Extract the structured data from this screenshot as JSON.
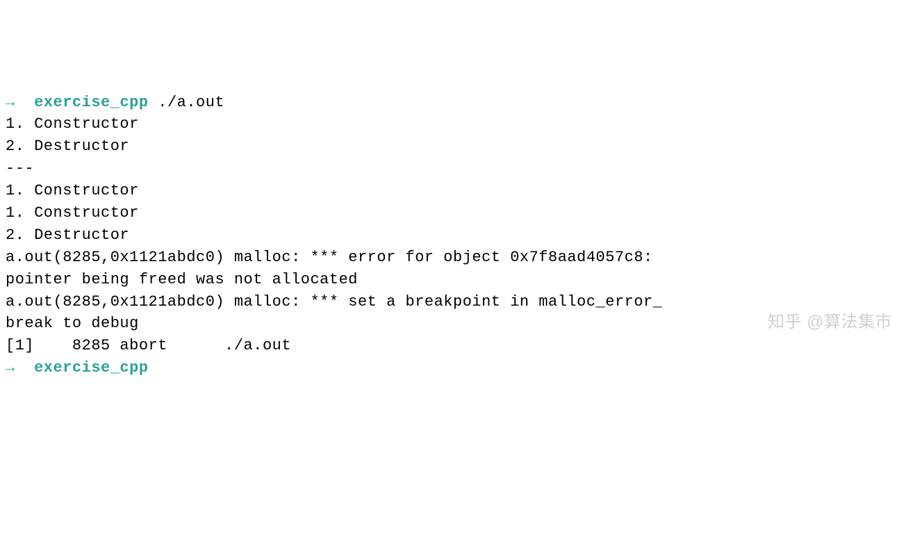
{
  "terminal": {
    "lines": [
      {
        "segments": [
          {
            "text": "→  ",
            "class": "prompt-arrow"
          },
          {
            "text": "exercise_cpp",
            "class": "prompt-dir"
          },
          {
            "text": " ./a.out",
            "class": "normal"
          }
        ]
      },
      {
        "segments": [
          {
            "text": "1. Constructor",
            "class": "normal"
          }
        ]
      },
      {
        "segments": [
          {
            "text": "2. Destructor",
            "class": "normal"
          }
        ]
      },
      {
        "segments": [
          {
            "text": "---",
            "class": "normal"
          }
        ]
      },
      {
        "segments": [
          {
            "text": "1. Constructor",
            "class": "normal"
          }
        ]
      },
      {
        "segments": [
          {
            "text": "1. Constructor",
            "class": "normal"
          }
        ]
      },
      {
        "segments": [
          {
            "text": "2. Destructor",
            "class": "normal"
          }
        ]
      },
      {
        "segments": [
          {
            "text": "a.out(8285,0x1121abdc0) malloc: *** error for object 0x7f8aad4057c8:",
            "class": "normal"
          }
        ]
      },
      {
        "segments": [
          {
            "text": "pointer being freed was not allocated",
            "class": "normal"
          }
        ]
      },
      {
        "segments": [
          {
            "text": "a.out(8285,0x1121abdc0) malloc: *** set a breakpoint in malloc_error_",
            "class": "normal"
          }
        ]
      },
      {
        "segments": [
          {
            "text": "break to debug",
            "class": "normal"
          }
        ]
      },
      {
        "segments": [
          {
            "text": "[1]    8285 abort      ./a.out",
            "class": "normal"
          }
        ]
      },
      {
        "segments": [
          {
            "text": "→  ",
            "class": "prompt-arrow"
          },
          {
            "text": "exercise_cpp",
            "class": "prompt-dir"
          }
        ]
      }
    ],
    "watermark": "知乎 @算法集市"
  }
}
